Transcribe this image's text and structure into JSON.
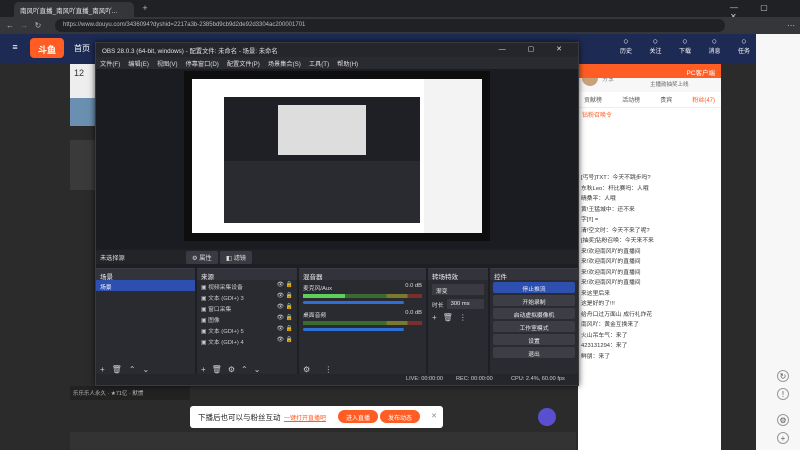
{
  "browser": {
    "tab_title": "南风吖直播_南风吖直播_南风吖...",
    "url": "https://www.douyu.com/3436094?dyshid=2217a3b-2385bd9cb9d2de92d3304ac200001701"
  },
  "site": {
    "nav_home": "首页",
    "logo": "斗鱼",
    "room_num": "12",
    "header_icons": [
      "历史",
      "关注",
      "下载",
      "消息",
      "任务"
    ],
    "right_tab1": "PC客户端",
    "right_tab2": "主播勋抽奖上线"
  },
  "obs": {
    "title": "OBS 28.0.3 (64-bit, windows) - 配置文件: 未命名 - 场景: 未命名",
    "menu": [
      "文件(F)",
      "编辑(E)",
      "视图(V)",
      "停靠窗口(D)",
      "配置文件(P)",
      "场景集合(S)",
      "工具(T)",
      "帮助(H)"
    ],
    "no_source": "未选择源",
    "props_btn": "属性",
    "filters_btn": "滤镜",
    "scenes_title": "场景",
    "scene_item": "场景",
    "sources_title": "来源",
    "sources": [
      "视频采集设备",
      "文本 (GDI+) 3",
      "窗口采集",
      "图像",
      "文本 (GDI+) 5",
      "文本 (GDI+) 4"
    ],
    "mixer_title": "混音器",
    "mixer_tracks": [
      {
        "name": "麦克风/Aux",
        "db": "0.0 dB",
        "level": 0.35
      },
      {
        "name": "桌面音频",
        "db": "0.0 dB",
        "level": 0.0
      }
    ],
    "transitions_title": "转场特效",
    "transition_type": "渐变",
    "duration_label": "时长",
    "duration_value": "300 ms",
    "controls_title": "控件",
    "controls": [
      "停止推流",
      "开始录制",
      "启动虚拟摄像机",
      "工作室模式",
      "设置",
      "退出"
    ],
    "status": {
      "live": "LIVE: 00:00:00",
      "rec": "REC: 00:00:00",
      "cpu": "CPU: 2.4%, 60.00 fps"
    }
  },
  "right": {
    "tabs": [
      "贡献榜",
      "活动榜",
      "贵宾",
      "粉丝(47)"
    ],
    "gift_note": "钻粉召唤令",
    "fans_label": "分享",
    "chat": [
      "[丐号]TXT：今天不跳步吗?",
      "东秋Leo：杆比赛吗：人哦",
      "晴桑平：人哦",
      "黄!王猛城中：还不来",
      "字[!!] =",
      "清!空文时：今天不来了呢?",
      "[抽奖]钻粉召唤：今天来不来",
      "来!欢迎南风吖的直播间",
      "来!欢迎南风吖的直播间",
      "来!欢迎南风吖的直播间",
      "来!欢迎南风吖的直播间",
      "来这里后来",
      "这是好的了!!!",
      "给舟口过万面山 成行礼炸花",
      "南风吖：黄金互换来了",
      "火山吊车气：来了",
      "423131294：来了",
      "鲜朋：来了"
    ]
  },
  "banner": {
    "text": "下播后也可以与粉丝互动",
    "link": "一键打开直播吧",
    "btn1": "进入直播",
    "btn2": "发布动态"
  },
  "colors": {
    "accent": "#ff5d23",
    "obs_stop": "#2d4fb0",
    "site_header": "#1d2a54"
  }
}
